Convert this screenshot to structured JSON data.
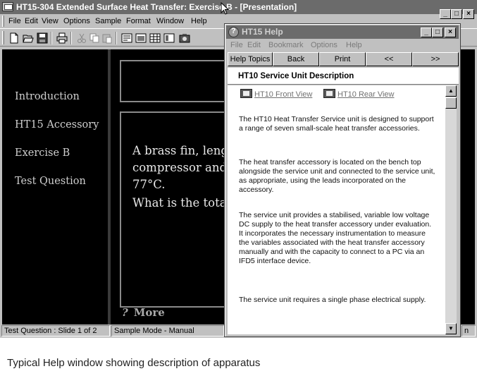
{
  "main_window": {
    "title": "HT15-304 Extended Surface Heat Transfer:  Exercise B - [Presentation]",
    "menu": [
      "File",
      "Edit",
      "View",
      "Options",
      "Sample",
      "Format",
      "Window",
      "Help"
    ],
    "caption_buttons": [
      "_",
      "□",
      "×"
    ],
    "toolbar_icons": [
      "new-file-icon",
      "open-folder-icon",
      "save-icon",
      "print-icon",
      "cut-icon",
      "copy-icon",
      "paste-icon",
      "slide-view-icon",
      "chart-view-icon",
      "table-view-icon",
      "panel-view-icon",
      "camera-icon"
    ]
  },
  "presentation": {
    "nav_items": [
      "Introduction",
      "HT15 Accessory",
      "Exercise B",
      "Test Question"
    ],
    "slide_lines": [
      "A brass fin, leng",
      "compressor and",
      "77°C.",
      "What is the total"
    ],
    "more_icon": "?",
    "more_label": "More"
  },
  "statusbar": {
    "slide_info": "Test Question : Slide 1 of 2",
    "mode": "Sample Mode - Manual",
    "trailing": "n"
  },
  "help_window": {
    "title": "HT15 Help",
    "menu": [
      "File",
      "Edit",
      "Bookmark",
      "Options",
      "Help"
    ],
    "caption_buttons": [
      "_",
      "□",
      "×"
    ],
    "buttons": [
      "Help Topics",
      "Back",
      "Print",
      "<<",
      ">>"
    ],
    "heading": "HT10 Service Unit Description",
    "view_links": [
      "HT10 Front View",
      "HT10 Rear View"
    ],
    "paragraphs": [
      "The HT10 Heat Transfer Service unit is designed to support a range of seven small-scale heat transfer accessories.",
      "The heat transfer accessory is located on the bench top alongside the service unit and connected to the service unit, as appropriate, using the leads incorporated on the accessory.",
      "The service unit provides a stabilised, variable low voltage DC supply to the heat transfer accessory under evaluation. It incorporates the necessary instrumentation to measure the variables associated with the heat transfer accessory manually and with the capacity to connect to a PC via an IFD5 interface device.",
      "The service unit requires a single phase electrical supply."
    ]
  },
  "caption": "Typical Help window showing description of apparatus"
}
